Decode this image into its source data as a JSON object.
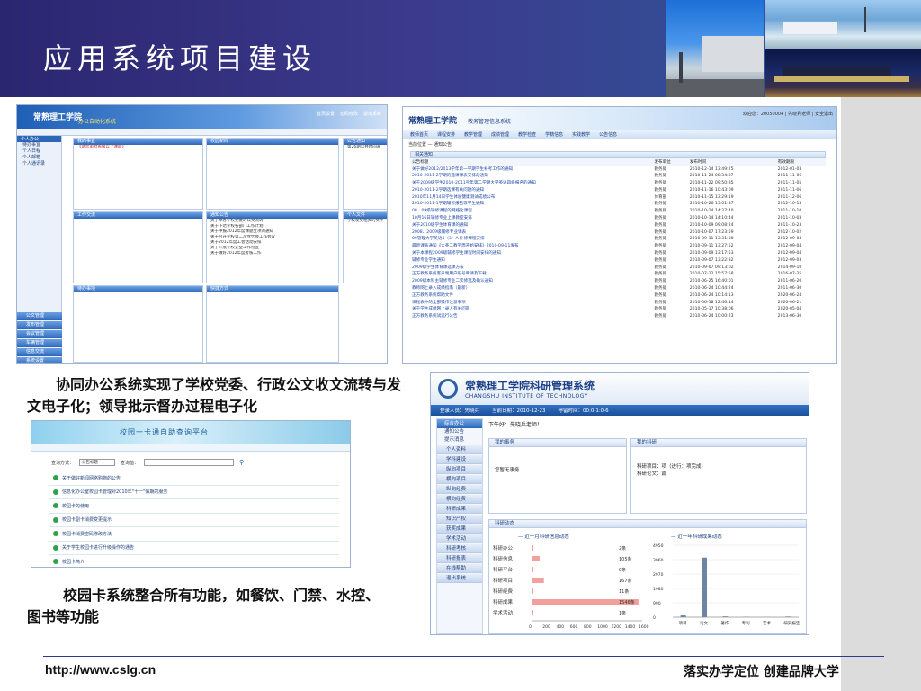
{
  "slide": {
    "title": "应用系统项目建设",
    "caption_office": "协同办公系统实现了学校党委、行政公文收文流转与发文电子化；领导批示督办过程电子化",
    "caption_card": "校园卡系统整合所有功能，如餐饮、门禁、水控、图书等功能",
    "footer_url": "http://www.cslg.cn",
    "footer_motto": "落实办学定位 创建品牌大学"
  },
  "oa": {
    "logo": "常熟理工学院",
    "subtitle": "办公自动化系统",
    "top_links": [
      "首页设置",
      "密码修改",
      "退出系统"
    ],
    "personal_heading": "个人办公",
    "personal_items": [
      "待办事宜",
      "个人日程",
      "个人邮箱",
      "个人通讯录"
    ],
    "modules": [
      "公文管理",
      "发布管理",
      "会议管理",
      "车辆管理",
      "信息交流",
      "系统设置"
    ],
    "panels": [
      {
        "title": "我的事宜",
        "lines": [
          "《请您审批省级以上课题》",
          "",
          "",
          ""
        ]
      },
      {
        "title": "公告通知",
        "lines": [
          "第26期公共时间表",
          "",
          "",
          ""
        ]
      },
      {
        "title": "校园新闻",
        "lines": [
          "",
          "",
          ""
        ]
      },
      {
        "title": "通知公告",
        "lines": [
          "关于举办学校党委的公文流转",
          "关于下达学校各部门工作计划",
          "关于申报2012年度课题立项的通知",
          "关于召开学校第二次党代会工作会议",
          "关于2012年度工会活动安排",
          "关于开展学校安全工作检查",
          "关于做好2012年度考核工作"
        ]
      },
      {
        "title": "工作交流",
        "lines": [
          "",
          ""
        ]
      },
      {
        "title": "待办事项",
        "lines": [
          "",
          ""
        ]
      },
      {
        "title": "个人文件",
        "lines": [
          "学校发文相关的文件",
          "2012年暑期工作安排"
        ]
      },
      {
        "title": "快捷方式",
        "lines": [
          "更多..."
        ]
      }
    ]
  },
  "edu": {
    "logo": "常熟理工学院",
    "subtitle": "教务管理信息系统",
    "user_text": "欢迎您：20050004 | 先晓兵老师 | 安全退出",
    "menu": [
      "教师首页",
      "课程安排",
      "教学管理",
      "成绩管理",
      "教学检查",
      "学籍信息",
      "实践教学",
      "公告信息"
    ],
    "breadcrumb": "当前位置 — 通知公告",
    "section": "相关通知",
    "columns": [
      "公告标题",
      "发布单位",
      "发布时间",
      "有效期限"
    ],
    "rows": [
      [
        "关于做好2012/2013学年第一学期学生补考工作的通知",
        "教务处",
        "2010-12-14 13:49:25",
        "2012-01-03"
      ],
      [
        "2010-2011-2学期的选课课表安排的通知",
        "教务处",
        "2010-11-24 08:34:37",
        "2011-11-06"
      ],
      [
        "关于2009级学生2010-2011学年第二学期大学英语四级报名的通知",
        "教务处",
        "2010-11-22 09:50:35",
        "2011-11-05"
      ],
      [
        "2010-2011-2学期选课有关问题的通知",
        "教务处",
        "2010-11-16 10:43:09",
        "2011-11-06"
      ],
      [
        "2010年11月14日学生体质健康测试成绩公布",
        "体育部",
        "2010-11-15 13:29:19",
        "2011-12-06"
      ],
      [
        "2010-2011-1学期辅修报名等学生通知",
        "教务处",
        "2010-10-26 15:01:37",
        "2012-10-13"
      ],
      [
        "08、09级辅修课程的网络化课程",
        "教务处",
        "2010-10-14 14:27:40",
        "2011-10-10"
      ],
      [
        "10月16日辅修专业上课教室安排",
        "教务处",
        "2010-10-14 14:10:44",
        "2011-10-03"
      ],
      [
        "关于2010级学生体育课的通知",
        "教务处",
        "2010-10-09 09:08:24",
        "2011-10-23"
      ],
      [
        "2008、2009级辅修专业课表",
        "教务处",
        "2010-10-07 17:23:59",
        "2012-10-02"
      ],
      [
        "09管理大学英语4（3）A 补修课程安排",
        "教务处",
        "2010-09-11 13:31:08",
        "2012-09-04"
      ],
      [
        "最新课表通知《大英二教学周开始安排》2010-09-11发布",
        "教务处",
        "2010-09-11 13:27:52",
        "2012-09-04"
      ],
      [
        "关于本课程2009级辅修学生课程时间安排的通知",
        "教务处",
        "2010-09-09 13:17:53",
        "2012-09-04"
      ],
      [
        "辅修专业学生通知",
        "教务处",
        "2010-09-07 13:22:32",
        "2012-09-03"
      ],
      [
        "2009级学生体育课选课方法",
        "教务处",
        "2010-09-07 09:13:02",
        "2014-09-10"
      ],
      [
        "正方教务系统客户端用户账号申请及下载",
        "教务处",
        "2010-07-12 15:57:58",
        "2016-07-25"
      ],
      [
        "2009级本科主辅修专业二次修选及确认通知",
        "教务处",
        "2010-06-25 16:40:01",
        "2011-06-20"
      ],
      [
        "教师网上录入成绩指南（最新）",
        "教务处",
        "2010-06-24 10:44:24",
        "2011-06-30"
      ],
      [
        "正方教务系统帮助文件",
        "教务处",
        "2010-06-24 10:14:13",
        "2020-06-24"
      ],
      [
        "课程表中的全部操作注意事项",
        "教务处",
        "2010-06-18 12:46:14",
        "2020-06-21"
      ],
      [
        "关于学生成绩网上录入有关问题",
        "教务处",
        "2010-05-17 10:38:06",
        "2020-05-04"
      ],
      [
        "正方教务系统试运行公告",
        "教务处",
        "2010-06-24 10:00:23",
        "2013-06-30"
      ]
    ]
  },
  "card": {
    "title": "校园一卡通自助查询平台",
    "search_label_1": "查询方式：",
    "search_value": "公告标题",
    "search_label_2": "查询值：",
    "items": [
      "关于做好新闻网络购物的公告",
      "信息化办公室校园卡管理对2010年\"十一\"假期的服务",
      "校园卡的使用",
      "校园卡副卡消费变更提示",
      "校园卡消费密码修改方法",
      "关于学生校园卡进行升级操作的通告",
      "校园卡简介"
    ]
  },
  "research": {
    "title": "常熟理工学院科研管理系统",
    "title_en": "CHANGSHU INSTITUTE OF TECHNOLOGY",
    "nav": [
      "登录人员：先晓兵",
      "当前日期：2010-12-23",
      "停留时间：00:0-1:0-6"
    ],
    "side_heading": "综合办公",
    "side_items": [
      "通知公告",
      "提示消息"
    ],
    "side_modules": [
      "个人资料",
      "学科建设",
      "纵向项目",
      "横向项目",
      "纵向经费",
      "横向经费",
      "科研成果",
      "知识产权",
      "获奖成果",
      "学术活动",
      "科研考核",
      "科研报表",
      "在线帮助",
      "退出系统"
    ],
    "greeting": "下午好：先晓兵老师！",
    "todo_title": "我的事务",
    "todo_text": "您暂无事务",
    "myres_title": "我的科研",
    "myres_lines": [
      "科研项目：项（进行：项完成）",
      "科研论文：篇"
    ],
    "dyn_title": "科研动态",
    "chart1_title": "近一月科研信息动态",
    "chart2_title": "近一年科研成果动态"
  },
  "chart_data": [
    {
      "type": "bar",
      "title": "近一月科研信息动态",
      "categories": [
        "科研办公",
        "科研信息",
        "科研平台",
        "科研项目",
        "科研经费",
        "科研成果",
        "学术活动"
      ],
      "values": [
        2,
        105,
        0,
        167,
        11,
        1546,
        1
      ],
      "value_labels": [
        "2条",
        "105条",
        "0条",
        "167条",
        "11条",
        "1546条",
        "1条"
      ],
      "xlim": [
        0,
        1600
      ],
      "xticks": [
        0,
        200,
        400,
        600,
        800,
        1000,
        1200,
        1400,
        1600
      ]
    },
    {
      "type": "bar",
      "title": "近一年科研成果动态",
      "categories": [
        "项目",
        "论文",
        "著作",
        "专利",
        "艺术",
        "研究报告"
      ],
      "values": [
        120,
        4100,
        50,
        20,
        10,
        40
      ],
      "ylim": [
        0,
        4950
      ],
      "yticks": [
        0,
        990,
        1980,
        2970,
        3960,
        4950
      ]
    }
  ]
}
